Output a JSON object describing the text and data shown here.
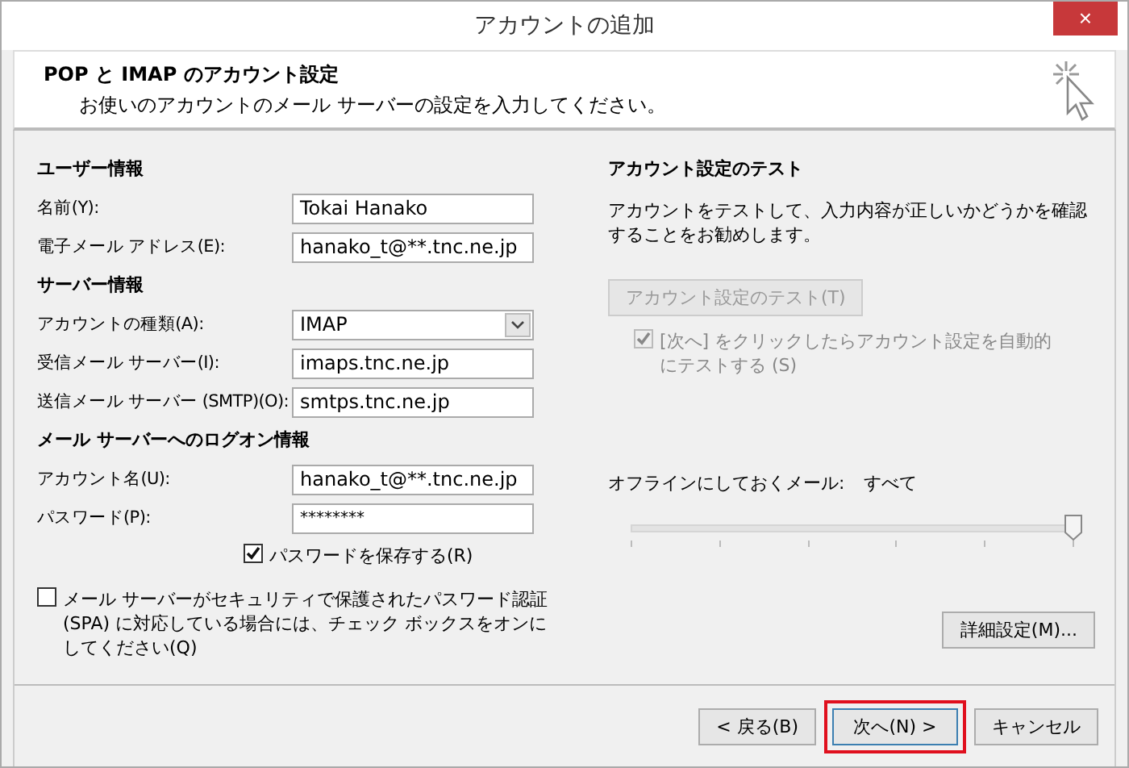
{
  "window": {
    "title": "アカウントの追加",
    "close": "×"
  },
  "header": {
    "title": "POP と IMAP のアカウント設定",
    "subtitle": "お使いのアカウントのメール サーバーの設定を入力してください。"
  },
  "sections": [
    {
      "title": "ユーザー情報",
      "fields": [
        {
          "kind": "text",
          "label": "名前(Y):",
          "value": "Tokai Hanako"
        },
        {
          "kind": "text",
          "label": "電子メール アドレス(E):",
          "value": "hanako_t@**.tnc.ne.jp"
        }
      ]
    },
    {
      "title": "サーバー情報",
      "fields": [
        {
          "kind": "select",
          "label": "アカウントの種類(A):",
          "value": "IMAP"
        },
        {
          "kind": "text",
          "label": "受信メール サーバー(I):",
          "value": "imaps.tnc.ne.jp"
        },
        {
          "kind": "text",
          "label": "送信メール サーバー (SMTP)(O):",
          "value": "smtps.tnc.ne.jp"
        }
      ]
    },
    {
      "title": "メール サーバーへのログオン情報",
      "fields": [
        {
          "kind": "text",
          "label": "アカウント名(U):",
          "value": "hanako_t@**.tnc.ne.jp"
        },
        {
          "kind": "password",
          "label": "パスワード(P):",
          "value": "********"
        }
      ]
    }
  ],
  "remember_password": {
    "label": "パスワードを保存する(R)",
    "checked": true
  },
  "spa": {
    "label": "メール サーバーがセキュリティで保護されたパスワード認証 (SPA) に対応している場合には、チェック ボックスをオンにしてください(Q)",
    "checked": false
  },
  "test": {
    "title": "アカウント設定のテスト",
    "description": "アカウントをテストして、入力内容が正しいかどうかを確認することをお勧めします。",
    "button": {
      "label": "アカウント設定のテスト(T)",
      "disabled": true
    },
    "auto_test": {
      "label": "[次へ] をクリックしたらアカウント設定を自動的にテストする (S)",
      "checked": true,
      "disabled": true
    }
  },
  "offline": {
    "label": "オフラインにしておくメール:",
    "value": "すべて",
    "level": 1
  },
  "advanced_button": "詳細設定(M)...",
  "footer_buttons": [
    {
      "label": "< 戻る(B)",
      "highlighted": false
    },
    {
      "label": "次へ(N) >",
      "highlighted": true
    },
    {
      "label": "キャンセル",
      "highlighted": false
    }
  ]
}
